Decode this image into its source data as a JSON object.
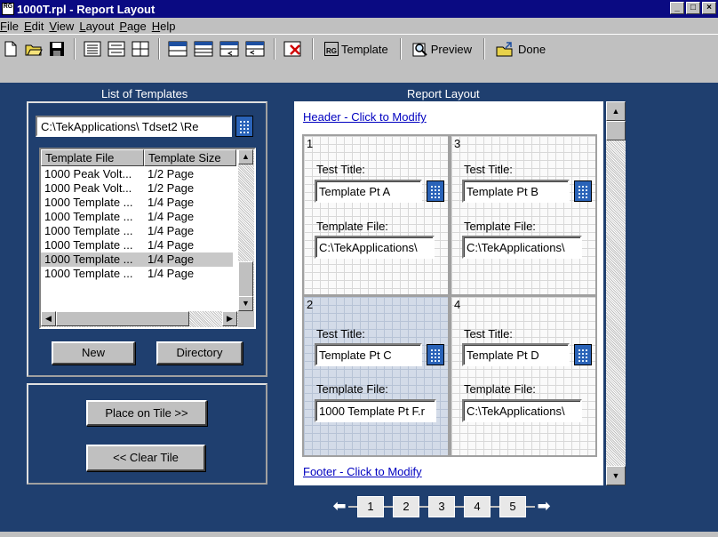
{
  "window": {
    "title": "1000T.rpl - Report Layout",
    "icon_text": "RG",
    "controls": [
      "_",
      "□",
      "×"
    ]
  },
  "menu": [
    {
      "label": "File",
      "key": "F",
      "rest": "ile"
    },
    {
      "label": "Edit",
      "key": "E",
      "rest": "dit"
    },
    {
      "label": "View",
      "key": "V",
      "rest": "iew"
    },
    {
      "label": "Layout",
      "key": "L",
      "rest": "ayout"
    },
    {
      "label": "Page",
      "key": "P",
      "rest": "age"
    },
    {
      "label": "Help",
      "key": "H",
      "rest": "elp"
    }
  ],
  "toolbar": {
    "template_label": "Template",
    "template_icon_text": "RG",
    "preview_label": "Preview",
    "done_label": "Done"
  },
  "left": {
    "list_title": "List of Templates",
    "path_value": "C:\\TekApplications\\ Tdset2  \\Re",
    "columns": [
      "Template File",
      "Template Size"
    ],
    "rows": [
      {
        "file": "1000 Peak Volt...",
        "size": "1/2 Page"
      },
      {
        "file": "1000 Peak Volt...",
        "size": "1/2 Page"
      },
      {
        "file": "1000 Template ...",
        "size": "1/4 Page"
      },
      {
        "file": "1000 Template ...",
        "size": "1/4 Page"
      },
      {
        "file": "1000 Template ...",
        "size": "1/4 Page"
      },
      {
        "file": "1000 Template ...",
        "size": "1/4 Page"
      },
      {
        "file": "1000 Template ...",
        "size": "1/4 Page"
      },
      {
        "file": "1000 Template ...",
        "size": "1/4 Page"
      }
    ],
    "selected_row": 6,
    "new_label": "New",
    "directory_label": "Directory",
    "place_label": "Place on Tile >>",
    "clear_label": "<< Clear Tile"
  },
  "report": {
    "title": "Report Layout",
    "header_link": "Header - Click to Modify",
    "footer_link": "Footer - Click to Modify",
    "test_title_label": "Test Title:",
    "template_file_label": "Template File:",
    "tiles": [
      {
        "num": "1",
        "test_title": "Template Pt A",
        "file": "C:\\TekApplications\\"
      },
      {
        "num": "3",
        "test_title": "Template Pt B",
        "file": "C:\\TekApplications\\"
      },
      {
        "num": "2",
        "test_title": "Template Pt C",
        "file": "1000 Template Pt F.r"
      },
      {
        "num": "4",
        "test_title": "Template Pt D",
        "file": "C:\\TekApplications\\"
      }
    ],
    "active_tile": "2",
    "pages": [
      "1",
      "2",
      "3",
      "4",
      "5"
    ]
  }
}
